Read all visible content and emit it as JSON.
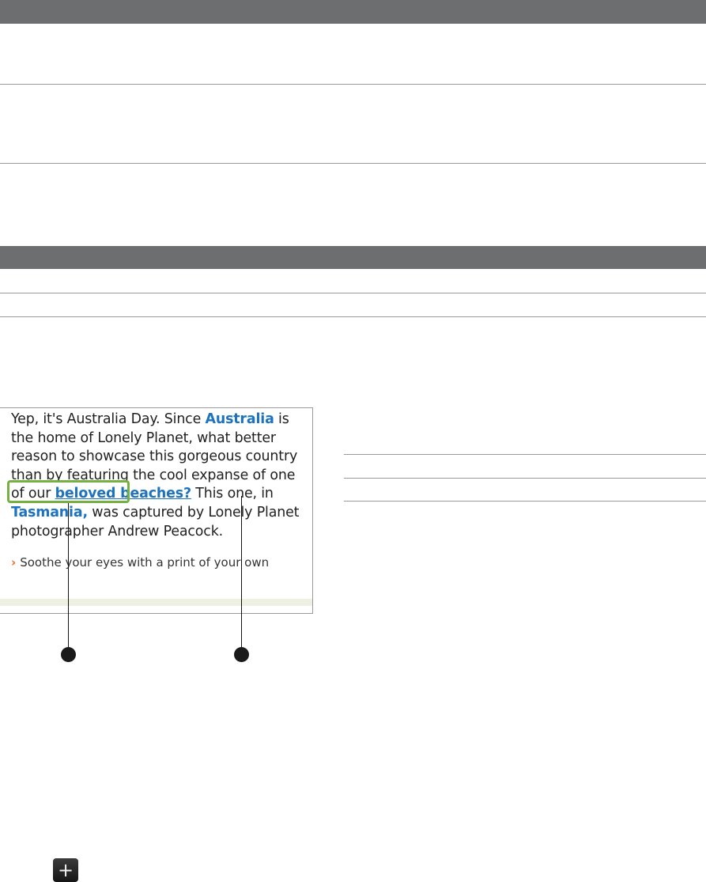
{
  "screenshot": {
    "paragraph": [
      {
        "text": "Yep, it's Australia Day. Since ",
        "style": "plain"
      },
      {
        "text": "Australia",
        "style": "link"
      },
      {
        "text": " is the home of Lonely Planet, what better reason to showcase this gorgeous country than by featuring the cool expanse of one of our ",
        "style": "plain"
      },
      {
        "text": "beloved beaches?",
        "style": "link-u"
      },
      {
        "text": " This one, in ",
        "style": "plain"
      },
      {
        "text": "Tasmania,",
        "style": "link"
      },
      {
        "text": " was captured by Lonely Planet photographer Andrew Peacock.",
        "style": "plain"
      }
    ],
    "more_link": "Soothe your eyes with a print of your own",
    "more_chevron": "›"
  },
  "icons": {
    "plus_icon": "+"
  },
  "colors": {
    "table_header": "#6d6e70",
    "link_blue": "#1e73be",
    "highlight_green": "#76b040",
    "chevron_orange": "#f26a21"
  }
}
